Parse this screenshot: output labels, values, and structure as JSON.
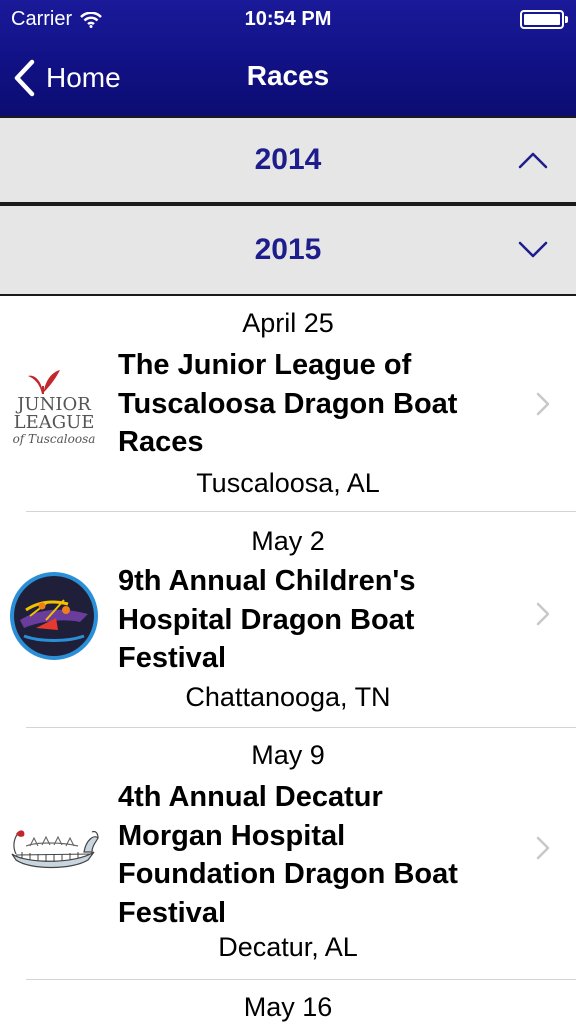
{
  "status_bar": {
    "carrier": "Carrier",
    "time": "10:54 PM"
  },
  "nav": {
    "back_label": "Home",
    "title": "Races"
  },
  "sections": [
    {
      "year": "2014",
      "expanded": false,
      "chevron_icon": "chevron-up-icon"
    },
    {
      "year": "2015",
      "expanded": true,
      "chevron_icon": "chevron-down-icon"
    }
  ],
  "races": [
    {
      "date": "April 25",
      "name_lines": [
        "The Junior League of",
        "Tuscaloosa Dragon Boat",
        "Races"
      ],
      "location": "Tuscaloosa, AL",
      "logo_icon": "junior-league-tuscaloosa-logo",
      "logo_text": {
        "line1": "JUNIOR",
        "line2": "LEAGUE",
        "line3": "of Tuscaloosa"
      }
    },
    {
      "date": "May 2",
      "name_lines": [
        "9th Annual Children's",
        "Hospital Dragon Boat",
        "Festival"
      ],
      "location": "Chattanooga, TN",
      "logo_icon": "childrens-hospital-dragon-boat-logo"
    },
    {
      "date": "May 9",
      "name_lines": [
        "4th Annual Decatur",
        "Morgan Hospital",
        "Foundation Dragon Boat",
        "Festival"
      ],
      "location": "Decatur, AL",
      "logo_icon": "dragon-boat-logo"
    },
    {
      "date": "May 16"
    }
  ],
  "colors": {
    "nav_bar": "#111185",
    "section_text": "#1d1d8c",
    "section_bg": "#e6e6e6"
  }
}
